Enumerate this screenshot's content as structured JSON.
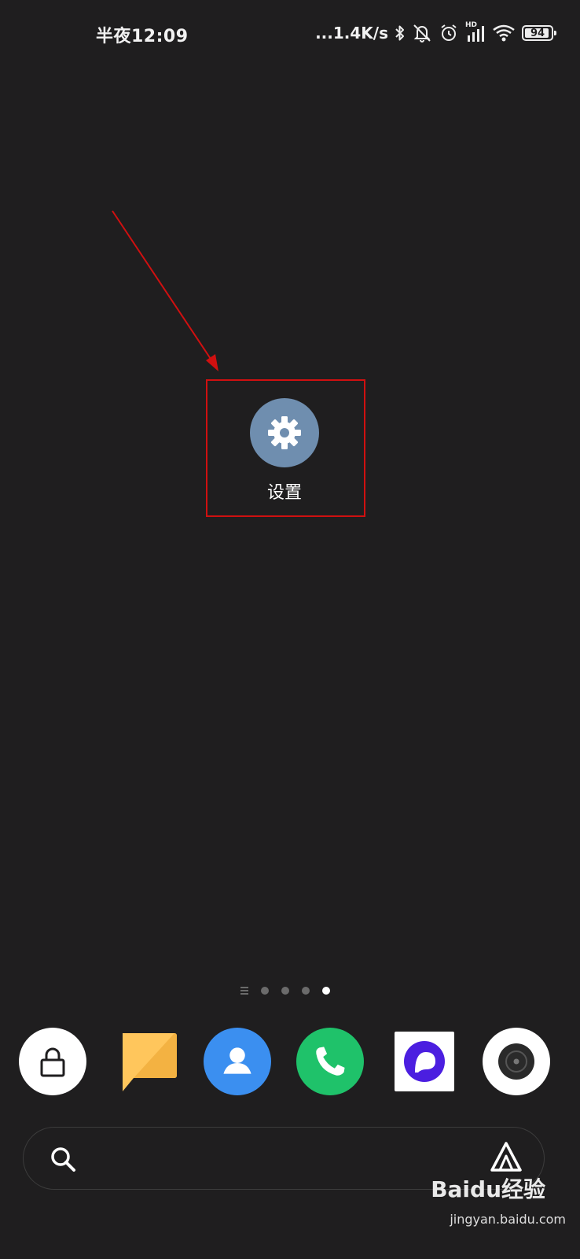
{
  "status_bar": {
    "time": "半夜12:09",
    "net_speed": "...1.4K/s",
    "network_badge": "HD",
    "battery_level": "94",
    "battery_percent": 94,
    "icons": [
      "bluetooth-icon",
      "mute-bell-icon",
      "alarm-icon",
      "signal-icon",
      "wifi-icon",
      "battery-icon"
    ]
  },
  "home": {
    "app_label": "设置",
    "app_icon": "gear-icon",
    "highlight_color": "#d01010"
  },
  "page_indicator": {
    "pages": 4,
    "active_index": 3
  },
  "dock": {
    "apps": [
      {
        "icon": "lock-icon",
        "bg": "#ffffff"
      },
      {
        "icon": "notes-icon",
        "bg": "#ffc65c"
      },
      {
        "icon": "contacts-icon",
        "bg": "#3b8ff0"
      },
      {
        "icon": "phone-icon",
        "bg": "#1fc26a"
      },
      {
        "icon": "browser-icon",
        "bg": "#ffffff"
      },
      {
        "icon": "camera-icon",
        "bg": "#ffffff"
      }
    ]
  },
  "search": {
    "icon": "search-icon",
    "assistant_icon": "assistant-icon"
  },
  "watermark": {
    "brand": "Baidu经验",
    "url": "jingyan.baidu.com"
  }
}
